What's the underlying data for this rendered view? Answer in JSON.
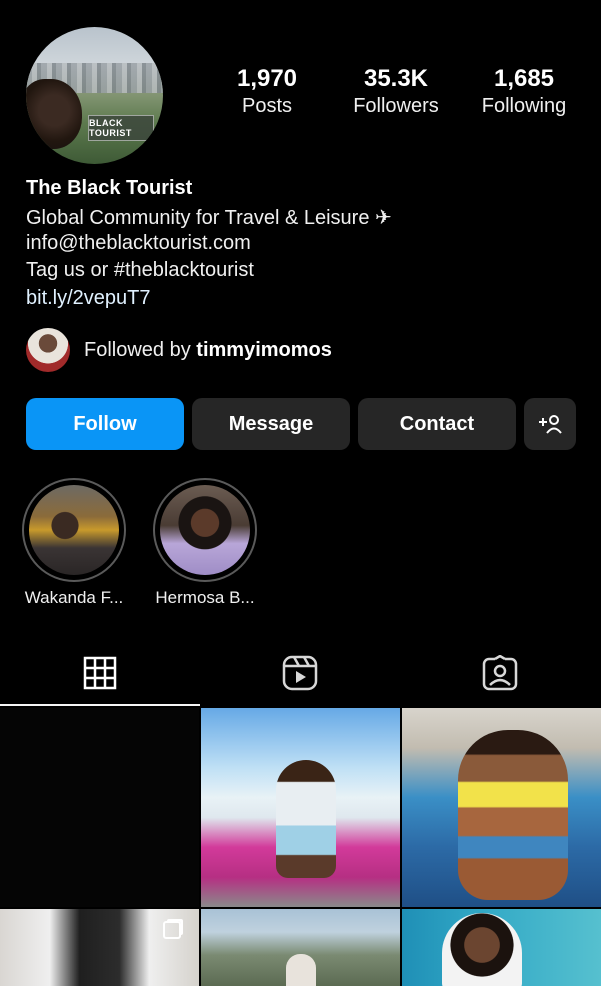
{
  "profile": {
    "name": "The Black Tourist",
    "avatar_logo_text": "BLACK TOURIST",
    "bio": [
      "Global Community for Travel & Leisure ✈",
      "info@theblacktourist.com",
      "Tag us or #theblacktourist",
      "bit.ly/2vepuT7"
    ]
  },
  "stats": [
    {
      "value": "1,970",
      "label": "Posts"
    },
    {
      "value": "35.3K",
      "label": "Followers"
    },
    {
      "value": "1,685",
      "label": "Following"
    }
  ],
  "followed_by": {
    "prefix": "Followed by",
    "user": "timmyimomos"
  },
  "buttons": {
    "follow": "Follow",
    "message": "Message",
    "contact": "Contact"
  },
  "highlights": [
    {
      "label": "Wakanda F..."
    },
    {
      "label": "Hermosa B..."
    }
  ],
  "tabs": [
    {
      "icon": "grid-icon",
      "active": true
    },
    {
      "icon": "reels-icon",
      "active": false
    },
    {
      "icon": "tagged-icon",
      "active": false
    }
  ],
  "colors": {
    "accent": "#0a95f6",
    "button_bg": "#262626",
    "background": "#000000"
  }
}
